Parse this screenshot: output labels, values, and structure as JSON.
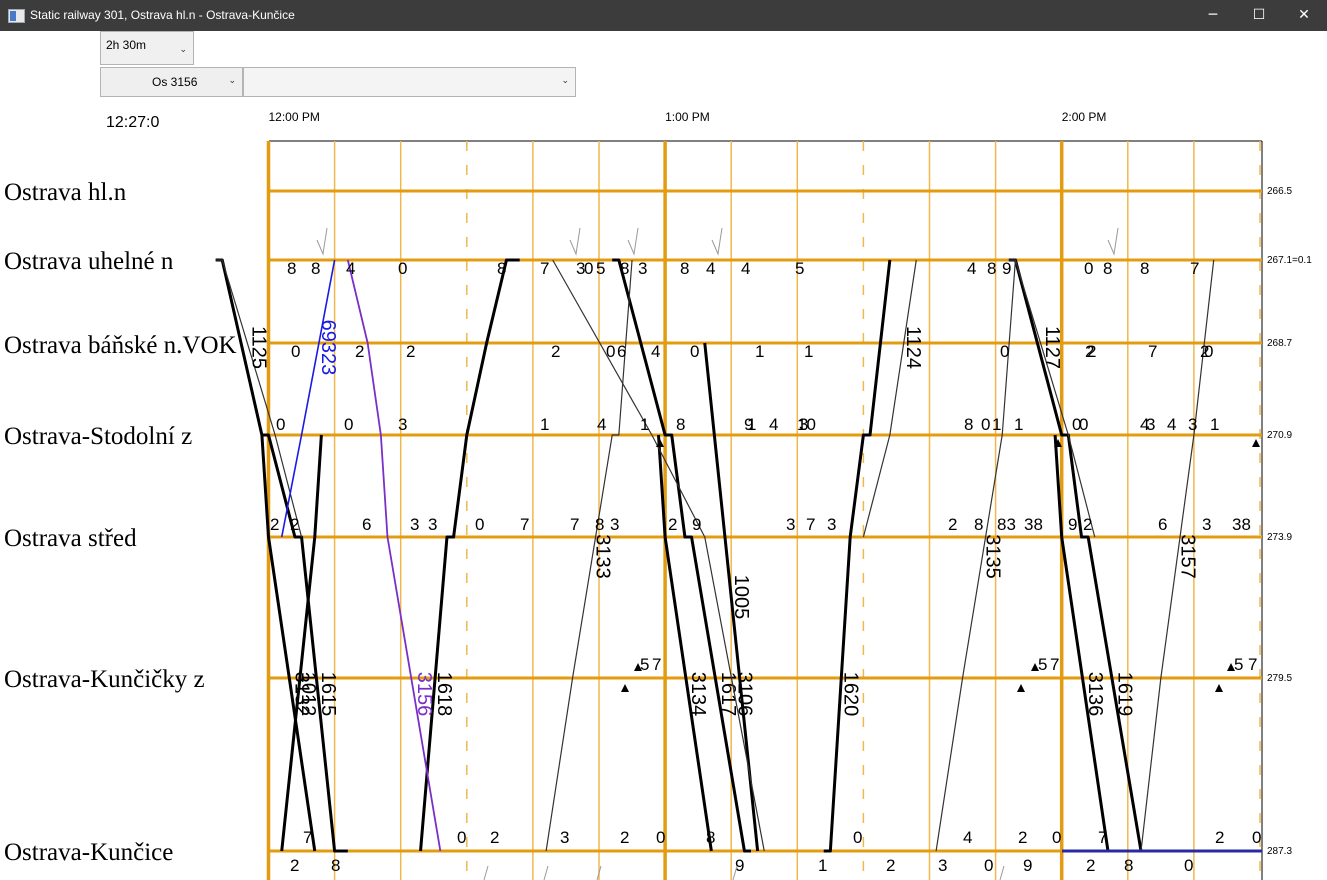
{
  "window": {
    "title": "Static railway 301, Ostrava hl.n - Ostrava-Kunčice",
    "minimize_glyph": "─",
    "maximize_glyph": "☐",
    "close_glyph": "✕"
  },
  "toolbar": {
    "duration_value": "2h 30m",
    "train_value": "Os 3156",
    "secondary_value": "",
    "current_time": "12:27:0"
  },
  "colors": {
    "titlebar_bg": "#3c3c3c",
    "grid": "#e39b10",
    "grid_light": "#f0b84c",
    "train_dark": "#000000",
    "train_thin": "#333333",
    "selected_train": "#7a2fc8",
    "blue_train": "#1a1ae6",
    "gray_arrow": "#9a9a9a"
  },
  "time_axis": {
    "labels": [
      {
        "time": "12:00",
        "text": "12:00 PM"
      },
      {
        "time": "13:00",
        "text": "1:00 PM"
      },
      {
        "time": "14:00",
        "text": "2:00 PM"
      }
    ]
  },
  "stations": [
    {
      "name": "Ostrava hl.n",
      "km": "266.5"
    },
    {
      "name": "Ostrava uhelné n",
      "km": "267.1=0.1"
    },
    {
      "name": "Ostrava báňské n.VOK",
      "km": "268.7"
    },
    {
      "name": "Ostrava-Stodolní z",
      "km": "270.9"
    },
    {
      "name": "Ostrava střed",
      "km": "273.9"
    },
    {
      "name": "Ostrava-Kunčičky z",
      "km": "279.5"
    },
    {
      "name": "Ostrava-Kunčice",
      "km": "287.3"
    }
  ],
  "trains": [
    {
      "number": "1615",
      "style": "bold",
      "stops": [
        [
          "11:52",
          "11:53",
          1
        ],
        [
          "11:59",
          "12:00",
          3
        ],
        [
          "12:04",
          "12:05",
          4
        ],
        [
          "12:10",
          "12:12",
          6
        ]
      ]
    },
    {
      "number": "1617",
      "style": "bold",
      "stops": [
        [
          "12:52",
          "12:53",
          1
        ],
        [
          "13:00",
          "13:01",
          3
        ],
        [
          "13:03",
          "13:04",
          4
        ],
        [
          "13:12",
          "13:13",
          6
        ]
      ]
    },
    {
      "number": "1619",
      "style": "bold",
      "stops": [
        [
          "13:52",
          "13:53",
          1
        ],
        [
          "14:00",
          "14:01",
          3
        ],
        [
          "14:03",
          "14:04",
          4
        ],
        [
          "14:12",
          "14:13",
          6
        ]
      ]
    },
    {
      "number": "1618",
      "style": "bold",
      "stops": [
        [
          "12:23",
          "12:23",
          6
        ],
        [
          "12:27",
          "12:28",
          4
        ],
        [
          "12:30",
          "12:30",
          3
        ],
        [
          "12:33",
          "12:33",
          2
        ],
        [
          "12:36",
          "12:38",
          1
        ]
      ]
    },
    {
      "number": "1620",
      "style": "bold",
      "stops": [
        [
          "13:24",
          "13:25",
          6
        ],
        [
          "13:28",
          "13:28",
          4
        ],
        [
          "13:30",
          "13:31",
          3
        ],
        [
          "13:34",
          "13:34",
          1
        ]
      ]
    },
    {
      "number": "1012",
      "style": "bold",
      "stops": [
        [
          "12:02",
          "12:02",
          6
        ],
        [
          "12:07",
          "12:07",
          4
        ],
        [
          "12:08",
          "12:08",
          3
        ]
      ]
    },
    {
      "number": "1005",
      "style": "bold",
      "stops": [
        [
          "13:06",
          "13:06",
          2
        ],
        [
          "13:14",
          "13:14",
          6
        ]
      ]
    },
    {
      "number": "3132",
      "style": "bold",
      "stops": [
        [
          "11:59",
          "11:59",
          3
        ],
        [
          "12:00",
          "12:00",
          4
        ],
        [
          "12:07",
          "12:07",
          6
        ]
      ]
    },
    {
      "number": "3134",
      "style": "bold",
      "stops": [
        [
          "12:59",
          "12:59",
          3
        ],
        [
          "13:00",
          "13:00",
          4
        ],
        [
          "13:07",
          "13:07",
          6
        ]
      ]
    },
    {
      "number": "3136",
      "style": "bold",
      "stops": [
        [
          "13:59",
          "13:59",
          3
        ],
        [
          "14:00",
          "14:00",
          4
        ],
        [
          "14:07",
          "14:07",
          6
        ]
      ]
    },
    {
      "number": "3133",
      "style": "thin",
      "stops": [
        [
          "12:42",
          "12:42",
          6
        ],
        [
          "12:46",
          "12:46",
          5
        ],
        [
          "12:52",
          "12:53",
          3
        ],
        [
          "12:55",
          "12:55",
          1
        ]
      ]
    },
    {
      "number": "3135",
      "style": "thin",
      "stops": [
        [
          "13:41",
          "13:41",
          6
        ],
        [
          "13:45",
          "13:45",
          5
        ],
        [
          "13:51",
          "13:51",
          3
        ],
        [
          "13:53",
          "13:53",
          1
        ]
      ]
    },
    {
      "number": "3157",
      "style": "thin",
      "stops": [
        [
          "14:12",
          "14:12",
          6
        ],
        [
          "14:15",
          "14:15",
          5
        ],
        [
          "14:20",
          "14:20",
          3
        ],
        [
          "14:23",
          "14:23",
          1
        ]
      ]
    },
    {
      "number": "3106",
      "style": "thin",
      "stops": [
        [
          "12:43",
          "12:43",
          1
        ],
        [
          "12:58",
          "12:58",
          3
        ],
        [
          "13:06",
          "13:06",
          4
        ],
        [
          "13:15",
          "13:15",
          6
        ]
      ]
    },
    {
      "number": "1125",
      "style": "thin",
      "stops": [
        [
          "11:52",
          "11:53",
          1
        ],
        [
          "12:01",
          "12:01",
          3
        ],
        [
          "12:05",
          "12:05",
          4
        ]
      ]
    },
    {
      "number": "1127",
      "style": "thin",
      "stops": [
        [
          "13:52",
          "13:53",
          1
        ],
        [
          "14:01",
          "14:01",
          3
        ],
        [
          "14:05",
          "14:05",
          4
        ]
      ]
    },
    {
      "number": "1124",
      "style": "thin",
      "stops": [
        [
          "13:30",
          "13:30",
          4
        ],
        [
          "13:34",
          "13:34",
          3
        ],
        [
          "13:38",
          "13:38",
          1
        ]
      ]
    },
    {
      "number": "69323",
      "style": "blue",
      "stops": [
        [
          "12:02",
          "12:02",
          4
        ],
        [
          "12:05",
          "12:05",
          3
        ],
        [
          "12:10",
          "12:10",
          1
        ]
      ]
    },
    {
      "number": "3156",
      "style": "selected",
      "stops": [
        [
          "12:12",
          "12:12",
          1
        ],
        [
          "12:15",
          "12:15",
          2
        ],
        [
          "12:17",
          "12:17",
          3
        ],
        [
          "12:18",
          "12:18",
          4
        ],
        [
          "12:26",
          "12:26",
          6
        ]
      ]
    }
  ],
  "minute_marks": {
    "r1": [
      "8",
      "4",
      "0",
      "8",
      "7",
      "3",
      "5",
      "3",
      "8",
      "4",
      "5",
      "4",
      "8",
      "0",
      "8",
      "7",
      "8",
      "9",
      "4",
      "8",
      "0",
      "8"
    ],
    "r2": [
      "2",
      "2",
      "0",
      "4",
      "1",
      "1",
      "0",
      "7",
      "2",
      "2",
      "0",
      "6",
      "0",
      "2",
      "2",
      "0"
    ],
    "r3": [
      "0",
      "0",
      "3",
      "1",
      "4",
      "1",
      "8",
      "9",
      "10",
      "8",
      "1",
      "0",
      "4",
      "3",
      "1",
      "3",
      "4",
      "0",
      "1",
      "0",
      "3",
      "4",
      "1"
    ],
    "r4": [
      "2",
      "2",
      "6",
      "3",
      "3",
      "0",
      "7",
      "7",
      "8",
      "3",
      "2",
      "9",
      "3",
      "7",
      "3",
      "2",
      "8",
      "83",
      "38",
      "2",
      "9",
      "6",
      "3",
      "38"
    ],
    "r5": [
      "5",
      "7",
      "5",
      "7",
      "5",
      "7"
    ],
    "r6": [
      "7",
      "0",
      "2",
      "3",
      "2",
      "0",
      "8",
      "0",
      "4",
      "2",
      "0",
      "7",
      "2",
      "0",
      "2",
      "8",
      "9",
      "1",
      "2",
      "3",
      "0",
      "9",
      "2",
      "8",
      "0"
    ]
  },
  "train_labels_visible": [
    "1615",
    "3156",
    "1012",
    "1618",
    "3133",
    "3134",
    "1617",
    "1005",
    "3106",
    "1620",
    "3135",
    "3136",
    "1619",
    "3157",
    "3132",
    "69323",
    "1125",
    "1127",
    "1124"
  ]
}
